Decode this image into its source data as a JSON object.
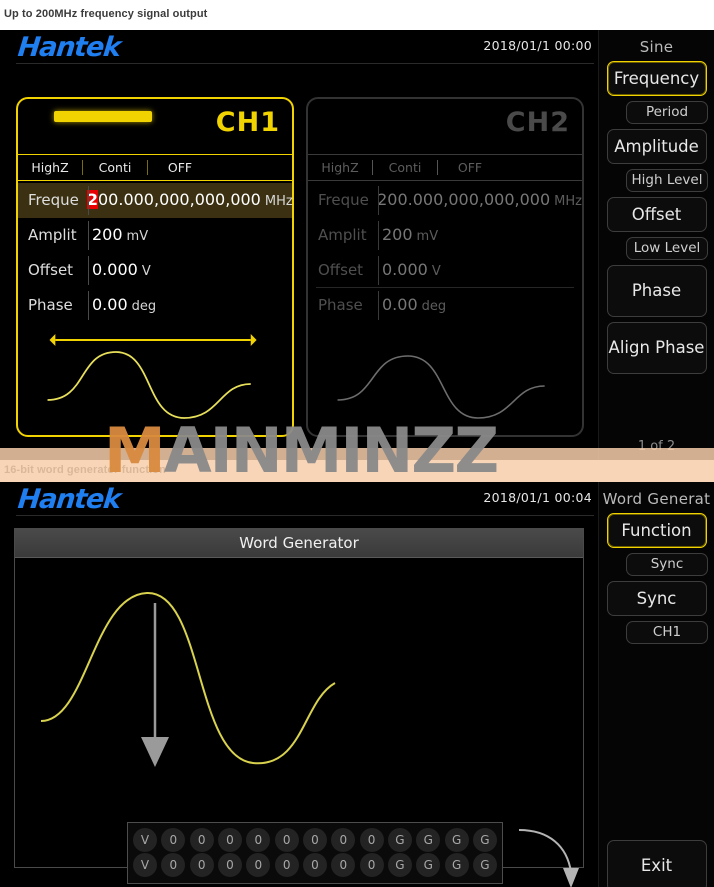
{
  "captions": {
    "top": "Up to 200MHz frequency signal output",
    "bottom": "16-bit word generator function"
  },
  "watermark": {
    "text_m": "M",
    "text_rest": "AINMINZZ"
  },
  "top_screen": {
    "brand": "Hantek",
    "clock": "2018/01/1 00:00",
    "channels": [
      {
        "name": "CH1",
        "tabs": [
          "HighZ",
          "Conti",
          "OFF"
        ],
        "rows": [
          {
            "label": "Freque",
            "cursor": "2",
            "value": "00.000,000,000,000",
            "unit": "MHz"
          },
          {
            "label": "Amplit",
            "cursor": "",
            "value": "200",
            "unit": "mV"
          },
          {
            "label": "Offset",
            "cursor": "",
            "value": "0.000",
            "unit": "V"
          },
          {
            "label": "Phase",
            "cursor": "",
            "value": "0.00",
            "unit": "deg"
          }
        ]
      },
      {
        "name": "CH2",
        "tabs": [
          "HighZ",
          "Conti",
          "OFF"
        ],
        "rows": [
          {
            "label": "Freque",
            "cursor": "",
            "value": "200.000,000,000,000",
            "unit": "MHz"
          },
          {
            "label": "Amplit",
            "cursor": "",
            "value": "200",
            "unit": "mV"
          },
          {
            "label": "Offset",
            "cursor": "",
            "value": "0.000",
            "unit": "V"
          },
          {
            "label": "Phase",
            "cursor": "",
            "value": "0.00",
            "unit": "deg"
          }
        ]
      }
    ],
    "menu": {
      "title": "Sine",
      "items": [
        {
          "label": "Frequency",
          "style": "wide",
          "selected": true
        },
        {
          "label": "Period",
          "style": "sub",
          "selected": false
        },
        {
          "label": "Amplitude",
          "style": "wide",
          "selected": false
        },
        {
          "label": "High Level",
          "style": "sub",
          "selected": false
        },
        {
          "label": "Offset",
          "style": "wide",
          "selected": false
        },
        {
          "label": "Low Level",
          "style": "sub",
          "selected": false
        },
        {
          "label": "Phase",
          "style": "tall",
          "selected": false
        },
        {
          "label": "Align Phase",
          "style": "tall",
          "selected": false
        }
      ],
      "page": "1 of 2"
    }
  },
  "bottom_screen": {
    "brand": "Hantek",
    "clock": "2018/01/1 00:04",
    "panel_title": "Word Generator",
    "bit_rows": [
      [
        "V",
        "0",
        "0",
        "0",
        "0",
        "0",
        "0",
        "0",
        "0",
        "G",
        "G",
        "G",
        "G"
      ],
      [
        "V",
        "0",
        "0",
        "0",
        "0",
        "0",
        "0",
        "0",
        "0",
        "G",
        "G",
        "G",
        "G"
      ]
    ],
    "menu": {
      "title": "Word Generat",
      "items": [
        {
          "label": "Function",
          "style": "wide",
          "selected": true
        },
        {
          "label": "Sync",
          "style": "sub",
          "selected": false
        },
        {
          "label": "Sync",
          "style": "wide",
          "selected": false
        },
        {
          "label": "CH1",
          "style": "sub",
          "selected": false
        }
      ],
      "exit_label": "Exit"
    }
  },
  "colors": {
    "brand_blue": "#1f7ef0",
    "accent_yellow": "#f2d302",
    "cursor_red": "#e60000",
    "watermark_orange": "#d98b3f"
  }
}
